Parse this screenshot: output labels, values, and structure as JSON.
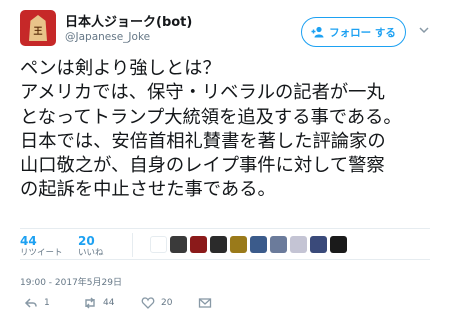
{
  "profile": {
    "display_name": "日本人ジョーク(bot)",
    "handle": "@Japanese_Joke",
    "avatar_glyph": "王"
  },
  "follow_button": {
    "label": "フォロー する"
  },
  "tweet": {
    "lines": [
      "ペンは剣より強しとは？",
      "アメリカでは、保守・リベラルの記者が一丸",
      "となってトランプ大統領を追及する事である。",
      "日本では、安倍首相礼賛書を著した評論家の",
      "山口敬之が、自身のレイプ事件に対して警察",
      "の起訴を中止させた事である。"
    ]
  },
  "stats": {
    "retweets": {
      "count": "44",
      "label": "リツイート"
    },
    "likes": {
      "count": "20",
      "label": "いいね"
    },
    "liker_avatar_colors": [
      "#ffffff",
      "#3a3a3a",
      "#8b1a1a",
      "#2b2b2b",
      "#9a7a1a",
      "#3b5b8b",
      "#6b7b9b",
      "#c4c4d4",
      "#3a4a7a",
      "#1a1a1a"
    ]
  },
  "timestamp": "19:00 - 2017年5月29日",
  "actions": {
    "reply_count": "1",
    "retweet_count": "44",
    "like_count": "20"
  },
  "colors": {
    "accent": "#1da1f2",
    "secondary_text": "#657786",
    "avatar_bg": "#c62828"
  }
}
